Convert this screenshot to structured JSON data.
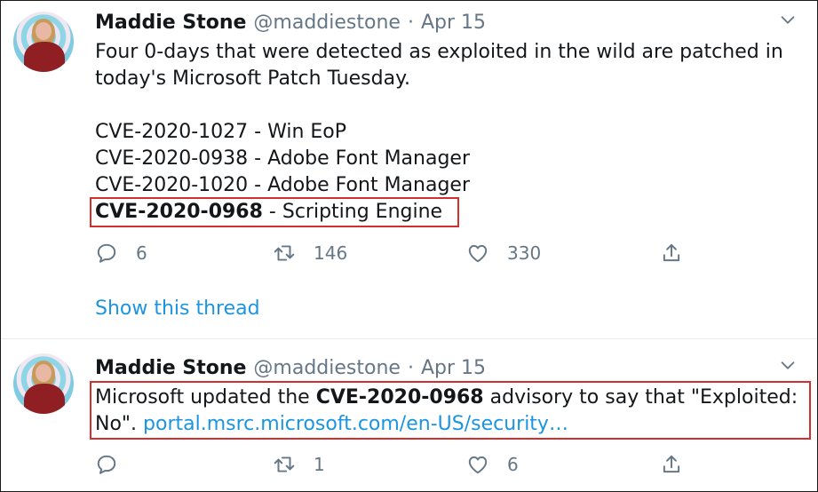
{
  "tweets": [
    {
      "author_name": "Maddie Stone",
      "handle": "@maddiestone",
      "separator": "·",
      "date": "Apr 15",
      "text_lines": [
        "Four 0-days that were detected as exploited in the wild are patched in",
        "today's Microsoft Patch Tuesday.",
        "CVE-2020-1027 - Win EoP",
        "CVE-2020-0938 - Adobe Font Manager",
        "CVE-2020-1020 - Adobe Font Manager"
      ],
      "highlight_cve": "CVE-2020-0968",
      "highlight_rest": " - Scripting Engine",
      "replies": "6",
      "retweets": "146",
      "likes": "330",
      "show_thread": "Show this thread"
    },
    {
      "author_name": "Maddie Stone",
      "handle": "@maddiestone",
      "separator": "·",
      "date": "Apr 15",
      "text_pre": "Microsoft updated the ",
      "text_bold": "CVE-2020-0968",
      "text_post": " advisory to say that \"Exploited:",
      "line2_pre": "No\". ",
      "link": "portal.msrc.microsoft.com/en-US/security…",
      "replies": "",
      "retweets": "1",
      "likes": "6"
    }
  ],
  "icons": {
    "reply": "reply-icon",
    "retweet": "retweet-icon",
    "like": "heart-icon",
    "share": "share-icon",
    "more": "chevron-down-icon"
  },
  "colors": {
    "text": "#14171a",
    "secondary": "#657786",
    "link": "#1b95e0",
    "highlight_border": "#d32f2f"
  }
}
